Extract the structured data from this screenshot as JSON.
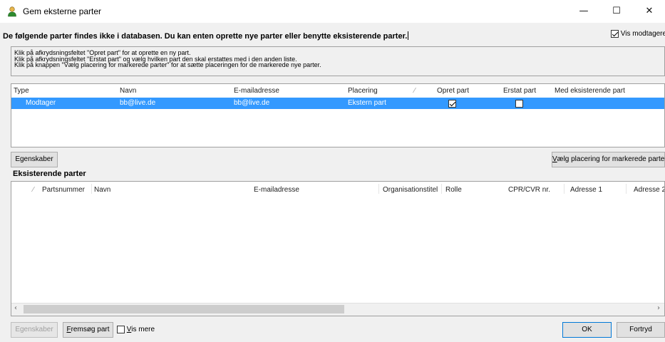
{
  "window": {
    "title": "Gem eksterne parter",
    "minimize": "—",
    "maximize": "☐",
    "close": "✕"
  },
  "headline": "De følgende parter findes ikke i databasen.  Du kan enten oprette nye parter eller benytte eksisterende parter.",
  "vis_modtagere": {
    "label": "Vis modtagere",
    "checked": true
  },
  "instructions": [
    "Klik på afkrydsningsfeltet \"Opret part\" for at oprette en ny part.",
    "Klik på afkrydsningsfeltet \"Erstat part\" og vælg hvilken part den skal erstattes med i den anden liste.",
    "Klik på knappen \"Vælg placering for markerede parter\" for at sætte placeringen for de markerede nye parter."
  ],
  "parties_grid": {
    "columns": [
      "Type",
      "Navn",
      "E-mailadresse",
      "Placering",
      "Opret part",
      "Erstat part",
      "Med eksisterende part"
    ],
    "rows": [
      {
        "type": "Modtager",
        "navn": "bb@live.de",
        "email": "bb@live.de",
        "placering": "Ekstern part",
        "opret": true,
        "erstat": false,
        "med_eksisterende": ""
      }
    ]
  },
  "buttons": {
    "egenskaber_top": "Egenskaber",
    "vaelg_placering_pre": "V",
    "vaelg_placering_rest": "ælg placering for markerede parter",
    "egenskaber_bottom": "Egenskaber",
    "fremsoeg_pre": "F",
    "fremsoeg_rest": "remsøg part",
    "ok": "OK",
    "fortryd": "Fortryd"
  },
  "existing_section_title": "Eksisterende parter",
  "existing_grid": {
    "columns": [
      "Partsnummer",
      "Navn",
      "E-mailadresse",
      "Organisationstitel",
      "Rolle",
      "CPR/CVR nr.",
      "Adresse 1",
      "Adresse 2"
    ]
  },
  "vis_mere": {
    "pre": "V",
    "rest": "is mere",
    "checked": false
  },
  "colors": {
    "selection": "#3399ff",
    "accent": "#0078d7"
  }
}
